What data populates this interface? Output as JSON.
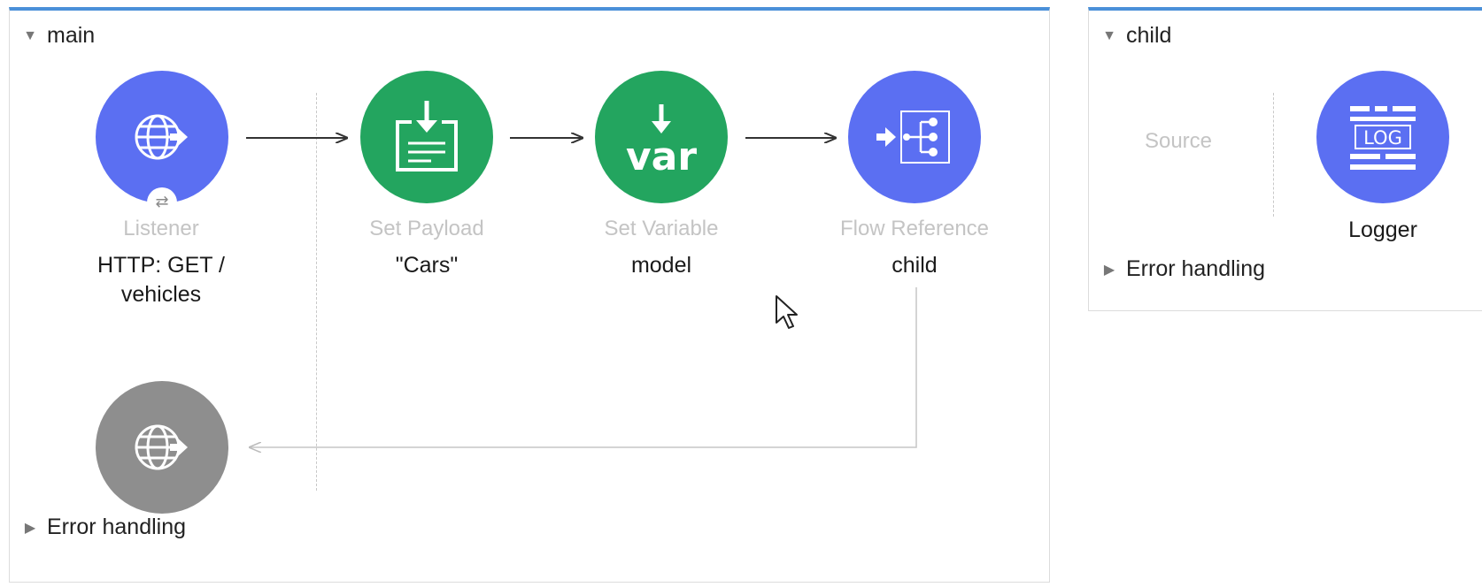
{
  "main_flow": {
    "title": "main",
    "error_handling": "Error handling",
    "listener": {
      "caption": "Listener",
      "value": "HTTP: GET /\nvehicles",
      "badge": "⇄"
    },
    "set_payload": {
      "caption": "Set Payload",
      "value": "\"Cars\""
    },
    "set_variable": {
      "caption": "Set Variable",
      "value": "model",
      "icon_text": "var"
    },
    "flow_reference": {
      "caption": "Flow Reference",
      "value": "child"
    }
  },
  "child_flow": {
    "title": "child",
    "source_label": "Source",
    "logger": {
      "value": "Logger",
      "icon_text": "LOG"
    },
    "error_handling": "Error handling"
  },
  "icons": {
    "listener": "globe-arrow-icon",
    "set_payload": "payload-icon",
    "set_variable": "variable-icon",
    "flow_reference": "flow-reference-icon",
    "logger": "log-icon",
    "response": "globe-arrow-icon",
    "collapse": "triangle-down-icon",
    "expand": "triangle-right-icon"
  },
  "colors": {
    "flow_border_accent": "#4a90d9",
    "node_blue": "#5b6ff2",
    "node_green": "#23a55f",
    "node_gray": "#8e8e8e",
    "caption_gray": "#c4c4c4"
  }
}
